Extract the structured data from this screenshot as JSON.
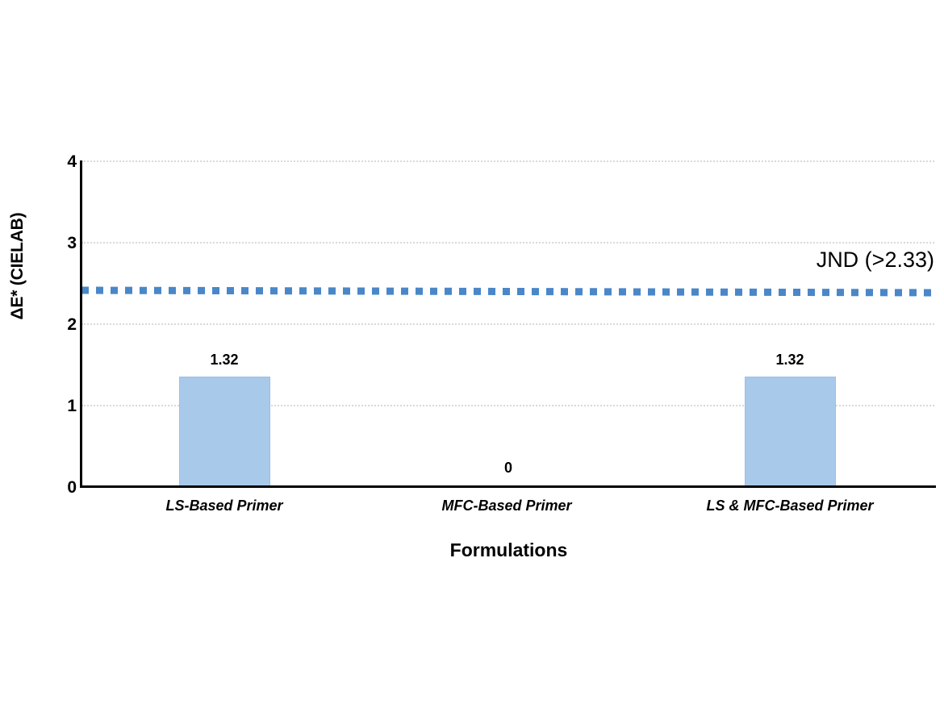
{
  "chart_data": {
    "type": "bar",
    "title": "",
    "subtitle": "",
    "xlabel": "Formulations",
    "ylabel": "ΔE* (CIELAB)",
    "categories": [
      "LS-Based Primer",
      "MFC-Based Primer",
      "LS & MFC-Based Primer"
    ],
    "values": [
      1.32,
      0,
      1.32
    ],
    "value_labels": [
      "1.32",
      "0",
      "1.32"
    ],
    "ylim": [
      0,
      4
    ],
    "ytick_labels": [
      "0",
      "1",
      "2",
      "3",
      "4"
    ],
    "ytick_values": [
      0,
      1,
      2,
      3,
      4
    ],
    "grid": "horizontal-dotted",
    "legend": "none",
    "bar_color": "#A8C9EA",
    "bar_edge_color": "#9CC0E4",
    "annotations": [
      {
        "name": "jnd-threshold-line",
        "label": "JND (>2.33)",
        "value": 2.4,
        "style": "dotted",
        "color": "#4A87C8"
      }
    ]
  },
  "axes": {
    "y": {
      "title": "ΔE* (CIELAB)",
      "ticks": [
        "0",
        "1",
        "2",
        "3",
        "4"
      ]
    },
    "x": {
      "title": "Formulations",
      "ticks": [
        "LS-Based Primer",
        "MFC-Based Primer",
        "LS & MFC-Based Primer"
      ]
    }
  },
  "colors": {
    "bar_fill": "#A8C9EA",
    "bar_edge": "#9CC0E4",
    "reference_line": "#4A87C8",
    "gridline": "#D9D9D9",
    "axis": "#000000",
    "background": "#FFFFFF"
  }
}
